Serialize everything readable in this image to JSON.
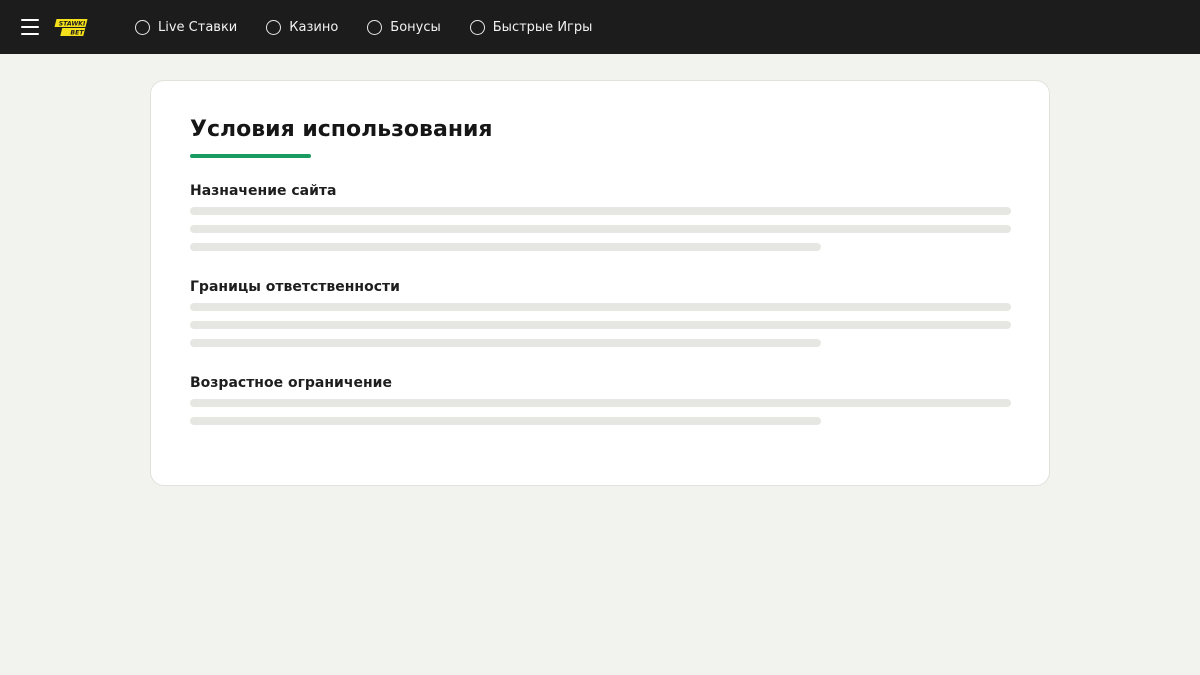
{
  "header": {
    "logo": {
      "text_top": "STAWKI",
      "text_bottom": "BET",
      "color": "#f5e11b"
    },
    "nav": [
      {
        "label": "Live Ставки",
        "icon": "circle-icon"
      },
      {
        "label": "Казино",
        "icon": "circle-icon"
      },
      {
        "label": "Бонусы",
        "icon": "circle-icon"
      },
      {
        "label": "Быстрые Игры",
        "icon": "circle-icon"
      }
    ],
    "background": "#1c1c1c"
  },
  "main": {
    "title": "Условия использования",
    "accent_color": "#1a9b62",
    "sections": [
      {
        "heading": "Назначение сайта",
        "lines": 3
      },
      {
        "heading": "Границы ответственности",
        "lines": 3
      },
      {
        "heading": "Возрастное ограничение",
        "lines": 2
      }
    ]
  }
}
